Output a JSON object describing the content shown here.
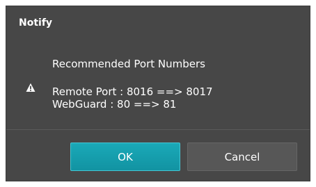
{
  "dialog": {
    "title": "Notify",
    "icon": "warning-icon",
    "heading": "Recommended Port Numbers",
    "lines": [
      "Remote Port : 8016 ==> 8017",
      "WebGuard : 80 ==> 81"
    ],
    "ok_label": "OK",
    "cancel_label": "Cancel",
    "colors": {
      "background": "#474747",
      "accent": "#1aa9b8",
      "text": "#ffffff"
    }
  }
}
